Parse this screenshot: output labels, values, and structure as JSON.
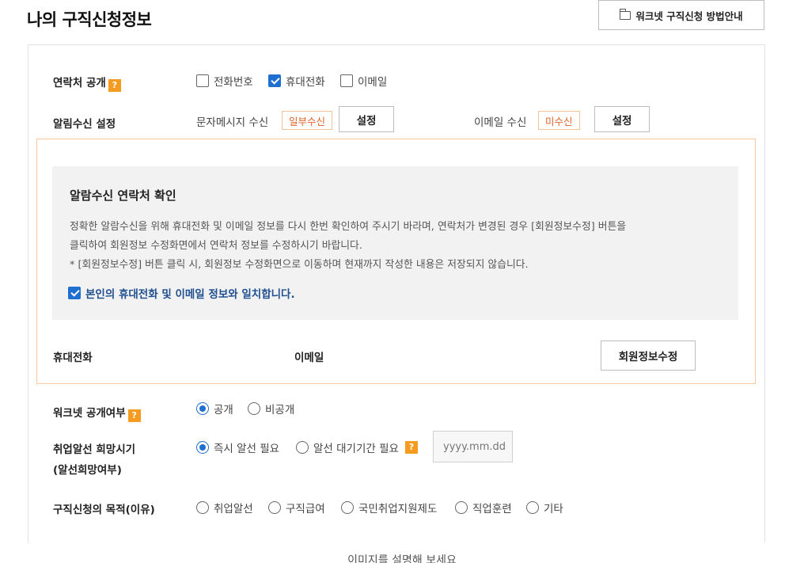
{
  "page": {
    "title": "나의 구직신청정보",
    "guide_button": "워크넷 구직신청 방법안내"
  },
  "contact_public": {
    "label": "연락처 공개",
    "options": [
      {
        "label": "전화번호",
        "checked": false
      },
      {
        "label": "휴대전화",
        "checked": true
      },
      {
        "label": "이메일",
        "checked": false
      }
    ]
  },
  "notification": {
    "label": "알림수신 설정",
    "sms_label": "문자메시지 수신",
    "sms_status": "일부수신",
    "sms_button": "설정",
    "email_label": "이메일 수신",
    "email_status": "미수신",
    "email_button": "설정"
  },
  "notice": {
    "title": "알람수신 연락처 확인",
    "line1": "정확한 알람수신을 위해 휴대전화 및 이메일 정보를 다시 한번 확인하여 주시기 바라며, 연락처가 변경된 경우 [회원정보수정] 버튼을",
    "line2": "클릭하여 회원정보 수정화면에서 연락처 정보를 수정하시기 바랍니다.",
    "line3": "* [회원정보수정] 버튼 클릭 시, 회원정보 수정화면으로 이동하며 현재까지 작성한 내용은 저장되지 않습니다.",
    "confirm_label": "본인의 휴대전화 및 이메일 정보와 일치합니다.",
    "confirm_checked": true
  },
  "contact_info": {
    "mobile_label": "휴대전화",
    "email_label": "이메일",
    "edit_button": "회원정보수정"
  },
  "worknet_public": {
    "label": "워크넷 공개여부",
    "options": [
      {
        "label": "공개",
        "selected": true
      },
      {
        "label": "비공개",
        "selected": false
      }
    ]
  },
  "placement_time": {
    "label_line1": "취업알선 희망시기",
    "label_line2": "(알선희망여부)",
    "options": [
      {
        "label": "즉시 알선 필요",
        "selected": true
      },
      {
        "label": "알선 대기기간 필요",
        "selected": false
      }
    ],
    "date_placeholder": "yyyy.mm.dd"
  },
  "purpose": {
    "label": "구직신청의 목적(이유)",
    "options": [
      {
        "label": "취업알선",
        "selected": false
      },
      {
        "label": "구직급여",
        "selected": false
      },
      {
        "label": "국민취업지원제도",
        "selected": false
      },
      {
        "label": "직업훈련",
        "selected": false
      },
      {
        "label": "기타",
        "selected": false
      }
    ]
  },
  "help_glyph": "?",
  "caption": "이미지를 설명해 보세요",
  "colors": {
    "accent_blue": "#1f6fd1",
    "help_orange": "#f59b1f",
    "status_orange": "#e0632a",
    "box_border": "#f5c79b"
  }
}
